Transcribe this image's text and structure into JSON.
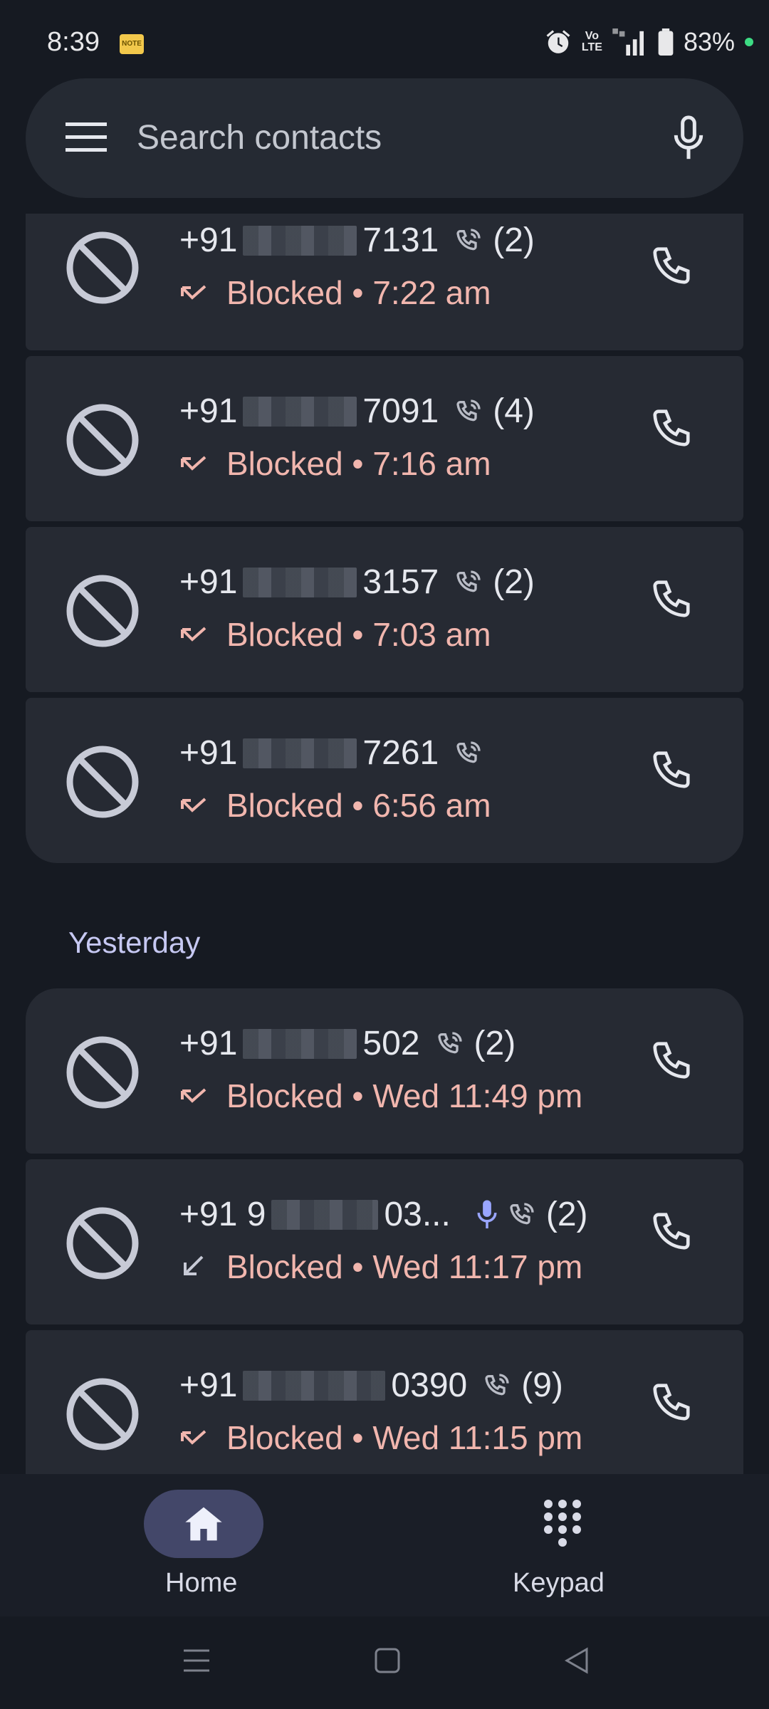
{
  "status_bar": {
    "time": "8:39",
    "note_icon": "sticky-note-icon",
    "volte": "Vo\nLTE",
    "battery": "83%"
  },
  "search": {
    "placeholder": "Search contacts"
  },
  "calls": [
    {
      "prefix": "+91",
      "suffix": "7131",
      "count": "(2)",
      "status": "Blocked • 7:22 am",
      "direction": "missed"
    },
    {
      "prefix": "+91",
      "suffix": "7091",
      "count": "(4)",
      "status": "Blocked • 7:16 am",
      "direction": "missed"
    },
    {
      "prefix": "+91",
      "suffix": "3157",
      "count": "(2)",
      "status": "Blocked • 7:03 am",
      "direction": "missed"
    },
    {
      "prefix": "+91",
      "suffix": "7261",
      "count": "",
      "status": "Blocked • 6:56 am",
      "direction": "missed"
    }
  ],
  "section_yesterday": "Yesterday",
  "calls_yesterday": [
    {
      "prefix": "+91",
      "suffix": "502",
      "count": "(2)",
      "status": "Blocked • Wed 11:49 pm",
      "direction": "missed"
    },
    {
      "prefix": "+91 9",
      "suffix": "03...",
      "count": "(2)",
      "status": "Blocked • Wed 11:17 pm",
      "direction": "incoming"
    },
    {
      "prefix": "+91",
      "suffix": "0390",
      "count": "(9)",
      "status": "Blocked • Wed 11:15 pm",
      "direction": "missed"
    }
  ],
  "nav": {
    "home": "Home",
    "keypad": "Keypad"
  },
  "colors": {
    "background": "#161a22",
    "card": "#262a33",
    "blocked_text": "#f1b6ae",
    "section_text": "#c6c8f2",
    "nav_active": "#434769"
  }
}
